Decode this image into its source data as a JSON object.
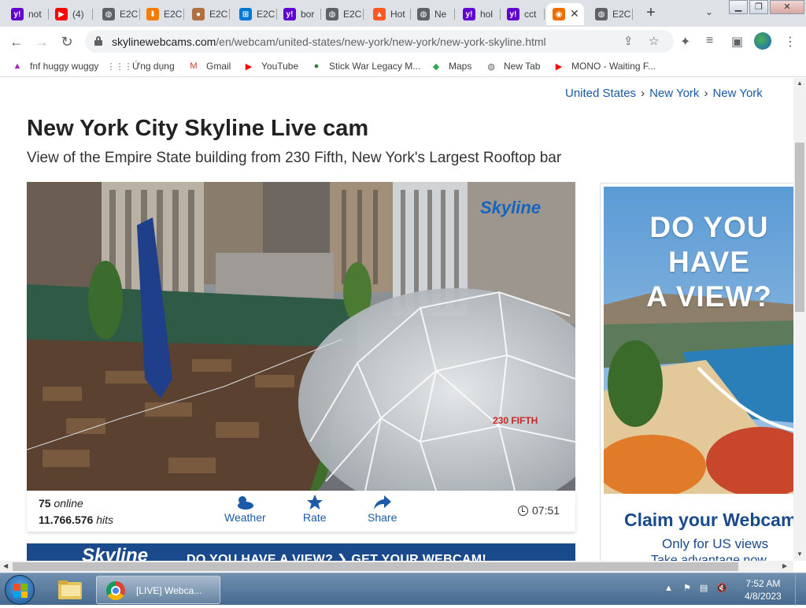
{
  "browser": {
    "tabs": [
      {
        "label": "not",
        "icon": "yahoo-icon",
        "color": "#6001d2",
        "glyph": "y!"
      },
      {
        "label": "(4)",
        "icon": "youtube-icon",
        "color": "#ff0000",
        "glyph": "▶"
      },
      {
        "label": "E2C",
        "icon": "globe-icon",
        "color": "#5f6368",
        "glyph": "◍"
      },
      {
        "label": "E2C",
        "icon": "arrow-down-icon",
        "color": "#f57c00",
        "glyph": "⬇"
      },
      {
        "label": "E2C",
        "icon": "cat-icon",
        "color": "#b07040",
        "glyph": "●"
      },
      {
        "label": "E2C",
        "icon": "windows-icon",
        "color": "#0078d4",
        "glyph": "⊞"
      },
      {
        "label": "bor",
        "icon": "yahoo-icon",
        "color": "#6001d2",
        "glyph": "y!"
      },
      {
        "label": "E2C",
        "icon": "globe-icon",
        "color": "#5f6368",
        "glyph": "◍"
      },
      {
        "label": "Hot",
        "icon": "hot-icon",
        "color": "#ff5722",
        "glyph": "▲"
      },
      {
        "label": "Ne",
        "icon": "globe-icon",
        "color": "#5f6368",
        "glyph": "◍"
      },
      {
        "label": "hol",
        "icon": "yahoo-icon",
        "color": "#6001d2",
        "glyph": "y!"
      },
      {
        "label": "cct",
        "icon": "yahoo-icon",
        "color": "#6001d2",
        "glyph": "y!"
      },
      {
        "label": "",
        "icon": "skyline-webcams-icon",
        "color": "#ef6c00",
        "glyph": "◉",
        "active": true
      },
      {
        "label": "E2C",
        "icon": "globe-icon",
        "color": "#5f6368",
        "glyph": "◍"
      }
    ],
    "url_host": "skylinewebcams.com",
    "url_path": "/en/webcam/united-states/new-york/new-york/new-york-skyline.html",
    "bookmarks": [
      {
        "label": "fnf huggy wuggy",
        "icon": "triangle-icon",
        "glyph": "▲",
        "color": "#9c27b0"
      },
      {
        "label": "Ứng dụng",
        "icon": "apps-grid-icon",
        "glyph": "⋮⋮⋮",
        "color": "#5f6368"
      },
      {
        "label": "Gmail",
        "icon": "gmail-icon",
        "glyph": "M",
        "color": "#d93025"
      },
      {
        "label": "YouTube",
        "icon": "youtube-icon",
        "glyph": "▶",
        "color": "#ff0000"
      },
      {
        "label": "Stick War Legacy M...",
        "icon": "stick-war-icon",
        "glyph": "●",
        "color": "#2e7d32"
      },
      {
        "label": "Maps",
        "icon": "maps-pin-icon",
        "glyph": "◆",
        "color": "#34a853"
      },
      {
        "label": "New Tab",
        "icon": "globe-icon",
        "glyph": "◍",
        "color": "#5f6368"
      },
      {
        "label": "MONO - Waiting F...",
        "icon": "youtube-icon",
        "glyph": "▶",
        "color": "#ff0000"
      }
    ]
  },
  "page": {
    "breadcrumb": [
      "United States",
      "New York",
      "New York"
    ],
    "title": "New York City Skyline Live cam",
    "subtitle": "View of the Empire State building from 230 Fifth, New York's Largest Rooftop bar",
    "cam_logo": "Skyline",
    "cam_overlay": "230 FIFTH",
    "stats": {
      "online_count": "75",
      "online_label": "online",
      "hits_count": "11.766.576",
      "hits_label": "hits"
    },
    "actions": {
      "weather": "Weather",
      "rate": "Rate",
      "share": "Share"
    },
    "time": "07:51",
    "banner_logo": "Skyline",
    "banner_text": "DO YOU HAVE A VIEW?  ❯  GET YOUR WEBCAM!",
    "ad": {
      "headline_line1": "DO YOU HAVE",
      "headline_line2": "A VIEW?",
      "claim": "Claim your Webcam",
      "sub": "Only for US views",
      "sub2": "Take advantage now"
    }
  },
  "taskbar": {
    "chrome_label": "[LIVE] Webca...",
    "time": "7:52 AM",
    "date": "4/8/2023"
  }
}
